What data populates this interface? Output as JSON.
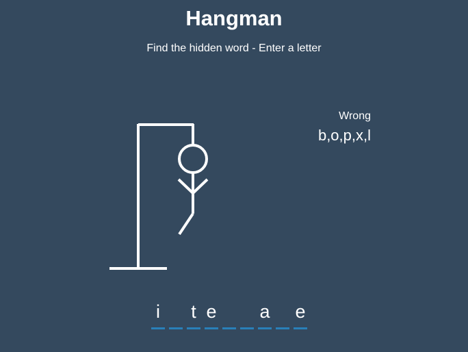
{
  "header": {
    "title": "Hangman",
    "subtitle": "Find the hidden word - Enter a letter"
  },
  "wrong": {
    "label": "Wrong",
    "letters": "b,o,p,x,l"
  },
  "word": {
    "slots": [
      "i",
      "",
      "t",
      "e",
      "",
      "",
      "a",
      "",
      "e"
    ],
    "underline_color": "#2980b9"
  },
  "colors": {
    "background": "#34495e",
    "foreground": "#ffffff"
  },
  "drawing": {
    "parts_shown": [
      "gallows",
      "head",
      "body",
      "left-arm",
      "right-arm",
      "left-leg"
    ]
  }
}
